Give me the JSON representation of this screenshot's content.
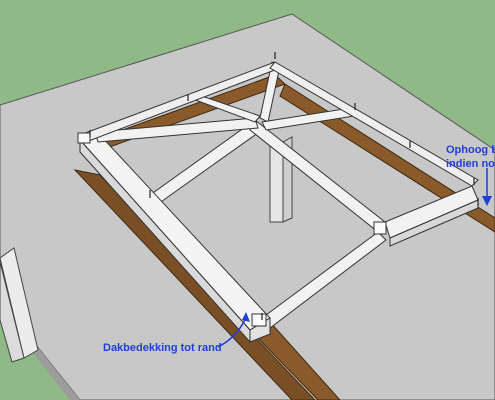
{
  "annotations": {
    "dakbedekking": "Dakbedekking tot rand",
    "ophoog_line1": "Ophoog b",
    "ophoog_line2": "indien noo"
  },
  "colors": {
    "background": "#8fba87",
    "roof": "#c8c8c8",
    "beam": "#8a5a2b",
    "frame": "#f2f2f2",
    "outline": "#333333",
    "annotation": "#1f3ed6"
  }
}
